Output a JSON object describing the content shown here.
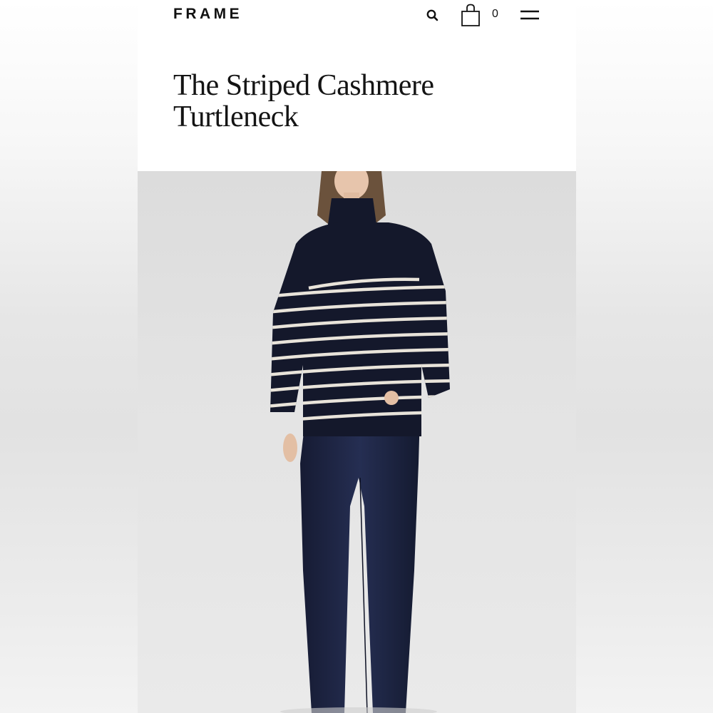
{
  "header": {
    "brand": "FRAME",
    "search_icon": "search-icon",
    "bag_icon": "shopping-bag-icon",
    "bag_count": "0",
    "menu_icon": "hamburger-menu-icon"
  },
  "product": {
    "title_line1": "The Striped Cashmere",
    "title_line2": "Turtleneck"
  },
  "colors": {
    "text": "#111111",
    "sweater": "#14182b",
    "stripe": "#e9e4da",
    "denim": "#1c2340"
  }
}
